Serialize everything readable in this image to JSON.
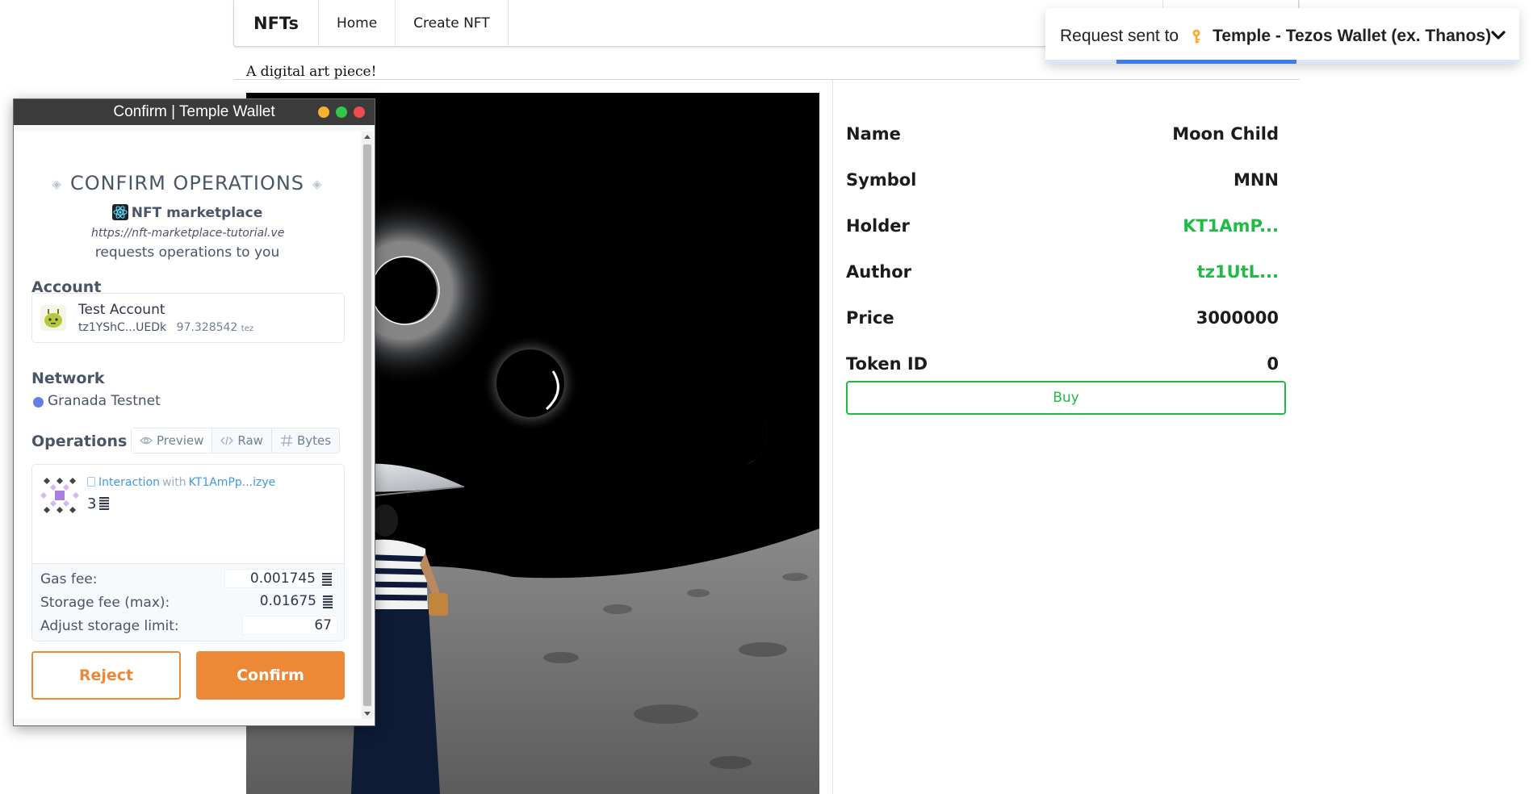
{
  "navbar": {
    "brand": "NFTs",
    "items": [
      {
        "label": "Home"
      },
      {
        "label": "Create NFT"
      }
    ]
  },
  "nft": {
    "description": "A digital art piece!",
    "details": [
      {
        "key": "Name",
        "value": "Moon Child",
        "accent": false
      },
      {
        "key": "Symbol",
        "value": "MNN",
        "accent": false
      },
      {
        "key": "Holder",
        "value": "KT1AmP...",
        "accent": true
      },
      {
        "key": "Author",
        "value": "tz1UtL...",
        "accent": true
      },
      {
        "key": "Price",
        "value": "3000000",
        "accent": false
      },
      {
        "key": "Token ID",
        "value": "0",
        "accent": false
      }
    ],
    "buy_label": "Buy",
    "accent_color": "#21ba45"
  },
  "toast": {
    "prefix": "Request sent to",
    "target": "Temple - Tezos Wallet (ex. Thanos)",
    "icon": "key-icon",
    "progress": 0.38
  },
  "wallet": {
    "window_title": "Confirm | Temple Wallet",
    "heading": "CONFIRM OPERATIONS",
    "app_name": "NFT marketplace",
    "app_url": "https://nft-marketplace-tutorial.ve",
    "requests_text": "requests operations to you",
    "account_heading": "Account",
    "account": {
      "name": "Test Account",
      "address": "tz1YShC...UEDk",
      "balance": "97.328542",
      "balance_unit": "tez"
    },
    "network_heading": "Network",
    "network": {
      "name": "Granada Testnet",
      "color": "#667eea"
    },
    "operations_heading": "Operations",
    "tabs": [
      {
        "label": "Preview",
        "icon": "eye-icon",
        "active": true
      },
      {
        "label": "Raw",
        "icon": "code-icon",
        "active": false
      },
      {
        "label": "Bytes",
        "icon": "hash-icon",
        "active": false
      }
    ],
    "operation": {
      "type": "Interaction",
      "with_text": "with",
      "contract": "KT1AmPp...izye",
      "amount": "3"
    },
    "fees": {
      "gas_label": "Gas fee:",
      "gas_value": "0.001745",
      "storage_label": "Storage fee (max):",
      "storage_value": "0.01675",
      "limit_label": "Adjust storage limit:",
      "limit_value": "67"
    },
    "reject_label": "Reject",
    "confirm_label": "Confirm",
    "brand_color": "#ed8936"
  }
}
